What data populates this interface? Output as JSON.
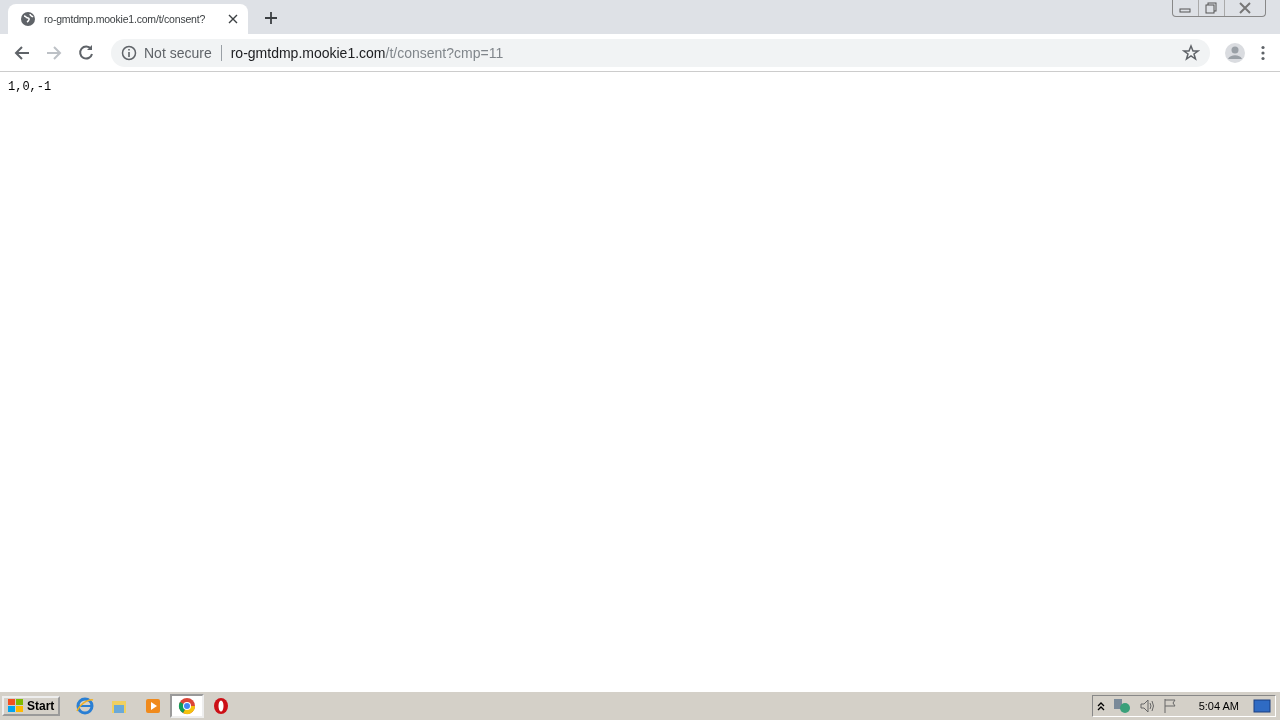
{
  "tabs": [
    {
      "title": "ro-gmtdmp.mookie1.com/t/consent?",
      "selected": true
    }
  ],
  "address_bar": {
    "security": "Not secure",
    "host": "ro-gmtdmp.mookie1.com",
    "path": "/t/consent?cmp=11"
  },
  "page": {
    "text": "1,0,-1"
  },
  "taskbar": {
    "start": "Start",
    "clock": "5:04 AM"
  }
}
